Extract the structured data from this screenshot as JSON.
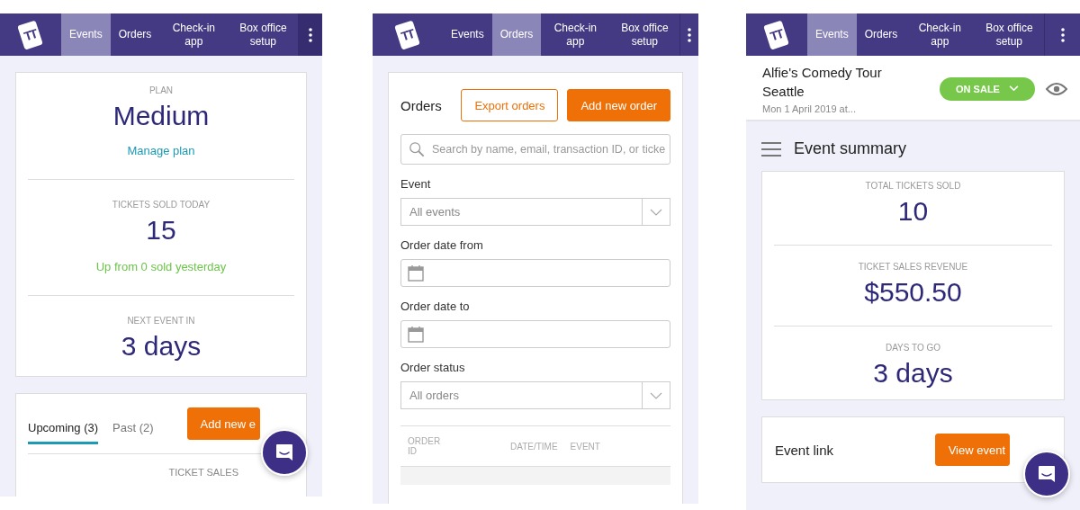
{
  "screens": [
    {
      "kind": "dashboard",
      "chat_button": true,
      "nav": {
        "logo": "TT",
        "tabs": [
          {
            "label": "Events",
            "selected": true
          },
          {
            "label": "Orders",
            "selected": false
          },
          {
            "label": "Check-in app",
            "selected": false
          },
          {
            "label": "Box office setup",
            "selected": false
          }
        ]
      },
      "stats": [
        {
          "label": "PLAN",
          "value": "Medium",
          "link": "Manage plan"
        },
        {
          "label": "TICKETS SOLD TODAY",
          "value": "15",
          "note": "Up from 0 sold yesterday"
        },
        {
          "label": "NEXT EVENT IN",
          "value": "3 days"
        }
      ],
      "list": {
        "tabs": [
          {
            "label": "Upcoming (3)",
            "selected": true
          },
          {
            "label": "Past (2)",
            "selected": false
          }
        ],
        "button": "Add new e",
        "columns": [
          "TICKET SALES"
        ]
      }
    },
    {
      "kind": "orders",
      "chat_button": false,
      "nav": {
        "logo": "TT",
        "tabs": [
          {
            "label": "Events",
            "selected": false
          },
          {
            "label": "Orders",
            "selected": true
          },
          {
            "label": "Check-in app",
            "selected": false
          },
          {
            "label": "Box office setup",
            "selected": false
          }
        ]
      },
      "title": "Orders",
      "buttons": [
        {
          "label": "Export orders",
          "kind": "outline"
        },
        {
          "label": "Add new order",
          "kind": "filled"
        }
      ],
      "search": {
        "placeholder": "Search by name, email, transaction ID, or ticke"
      },
      "filters": [
        {
          "label": "Event",
          "kind": "select",
          "value": "All events"
        },
        {
          "label": "Order date from",
          "kind": "date"
        },
        {
          "label": "Order date to",
          "kind": "date"
        },
        {
          "label": "Order status",
          "kind": "select",
          "value": "All orders"
        }
      ],
      "columns": [
        "ORDER ID",
        "DATE/TIME",
        "EVENT"
      ]
    },
    {
      "kind": "event",
      "chat_button": true,
      "nav": {
        "logo": "TT",
        "tabs": [
          {
            "label": "Events",
            "selected": true
          },
          {
            "label": "Orders",
            "selected": false
          },
          {
            "label": "Check-in app",
            "selected": false
          },
          {
            "label": "Box office setup",
            "selected": false
          }
        ]
      },
      "event": {
        "title": "Alfie's Comedy Tour Seattle",
        "date": "Mon 1 April 2019 at...",
        "status": "ON SALE"
      },
      "section_title": "Event summary",
      "stats": [
        {
          "label": "TOTAL TICKETS SOLD",
          "value": "10"
        },
        {
          "label": "TICKET SALES REVENUE",
          "value": "$550.50"
        },
        {
          "label": "DAYS TO GO",
          "value": "3 days"
        }
      ],
      "link_card": {
        "label": "Event link",
        "button": "View event"
      }
    }
  ]
}
